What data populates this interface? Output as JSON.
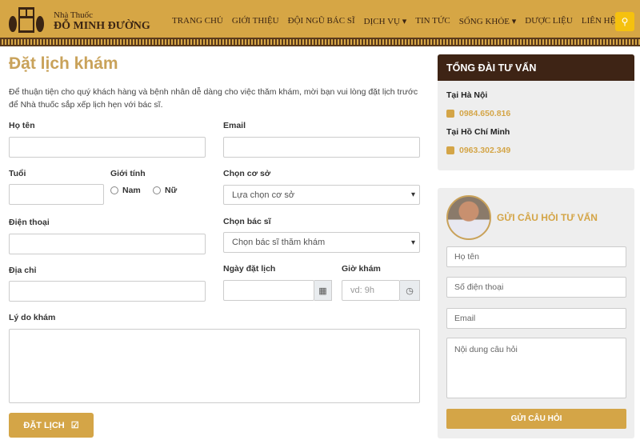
{
  "header": {
    "brand_top": "Nhà Thuốc",
    "brand_name": "ĐỖ MINH ĐƯỜNG",
    "logo_text": "đỗ minh",
    "nav": [
      {
        "label": "TRANG CHỦ"
      },
      {
        "label": "GIỚI THIỆU"
      },
      {
        "label": "ĐỘI NGŨ BÁC SĨ"
      },
      {
        "label": "DỊCH VỤ ▾"
      },
      {
        "label": "TIN TỨC"
      },
      {
        "label": "SỐNG KHỎE ▾"
      },
      {
        "label": "DƯỢC LIỆU"
      },
      {
        "label": "LIÊN HỆ"
      }
    ],
    "search_icon": "search-icon",
    "accent": "#d6a645"
  },
  "form": {
    "title": "Đặt lịch khám",
    "intro": "Để thuận tiện cho quý khách hàng và bệnh nhân dễ dàng cho việc thăm khám, mời bạn vui lòng đặt lịch trước để Nhà thuốc sắp xếp lịch hẹn với bác sĩ.",
    "name_label": "Họ tên",
    "email_label": "Email",
    "age_label": "Tuổi",
    "gender_label": "Giới tính",
    "male": "Nam",
    "female": "Nữ",
    "facility_label": "Chọn cơ sở",
    "facility_value": "Lựa chọn cơ sở",
    "phone_label": "Điện thoại",
    "doctor_label": "Chọn bác sĩ",
    "doctor_value": "Chọn bác sĩ thăm khám",
    "address_label": "Địa chỉ",
    "date_label": "Ngày đặt lịch",
    "time_label": "Giờ khám",
    "time_placeholder": "vd: 9h",
    "reason_label": "Lý do khám",
    "submit": "ĐẶT LỊCH"
  },
  "sidebar": {
    "hotline_title": "TỔNG ĐÀI TƯ VẤN",
    "city1": "Tại Hà Nội",
    "phone1": "0984.650.816",
    "city2": "Tại Hồ Chí Minh",
    "phone2": "0963.302.349",
    "ask_title": "GỬI CÂU HỎI TƯ VẤN",
    "ph_name": "Họ tên",
    "ph_phone": "Số điện thoại",
    "ph_email": "Email",
    "ph_question": "Nội dung câu hỏi",
    "ask_submit": "GỬI CÂU HỎI"
  }
}
